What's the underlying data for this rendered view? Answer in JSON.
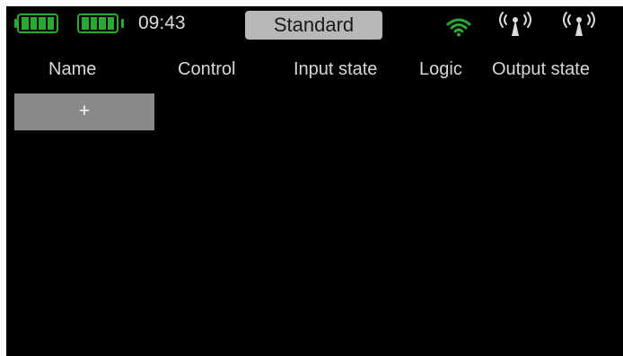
{
  "status_bar": {
    "batteries": [
      {
        "name": "transmitter-battery",
        "icon": "battery-icon",
        "color": "#2aa834"
      },
      {
        "name": "receiver-battery",
        "icon": "battery-icon",
        "color": "#2aa834"
      }
    ],
    "time": "09:43",
    "mode": "Standard",
    "wifi_icon": "wifi-icon",
    "wifi_color": "#2aa834",
    "antenna_icons": [
      "antenna-signal-icon",
      "antenna-signal-icon"
    ]
  },
  "table": {
    "columns": [
      "Name",
      "Control",
      "Input state",
      "Logic",
      "Output state"
    ],
    "add_label": "+"
  },
  "colors": {
    "background": "#000000",
    "accent": "#2aa834",
    "button": "#8a8a8a",
    "mode_pill": "#b8b8b8"
  }
}
